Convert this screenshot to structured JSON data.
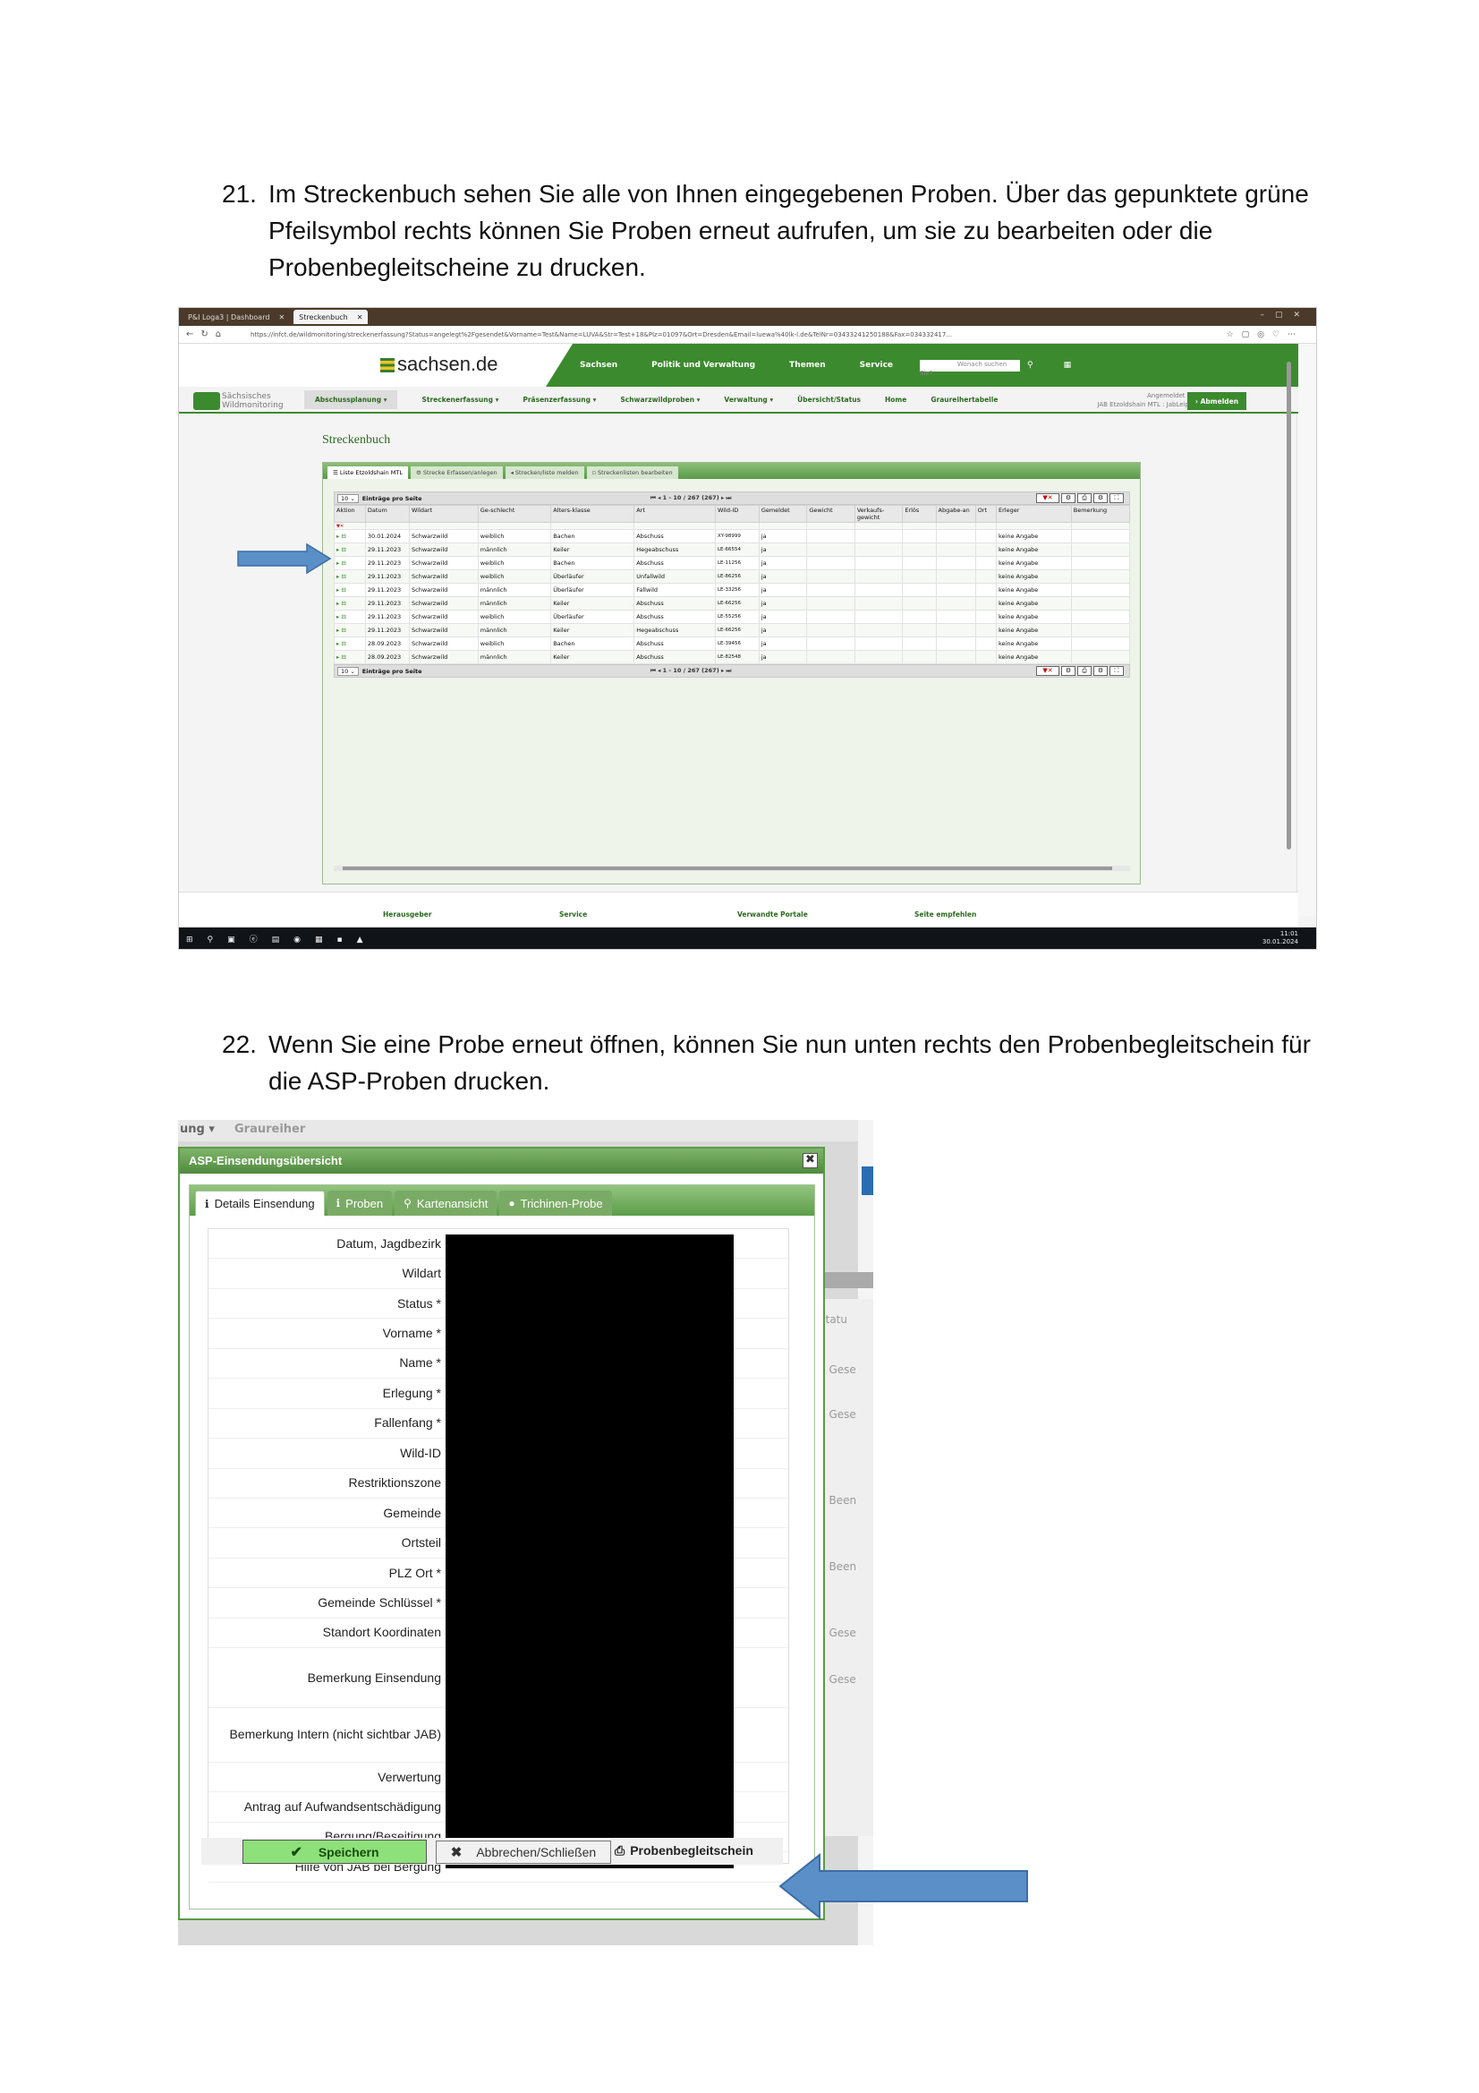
{
  "doc": {
    "step21": {
      "num": "21.",
      "text": "Im Streckenbuch sehen Sie alle von Ihnen eingegebenen Proben. Über das gepunktete grüne Pfeilsymbol rechts können Sie Proben erneut aufrufen, um sie zu bearbeiten oder die Probenbegleitscheine zu drucken."
    },
    "step22": {
      "num": "22.",
      "text": "Wenn Sie eine Probe erneut öffnen, können Sie nun unten rechts den Probenbegleitschein für die ASP-Proben drucken."
    }
  },
  "shot1": {
    "tabs": [
      "P&I Loga3 | Dashboard",
      "Streckenbuch"
    ],
    "url": "https://infct.de/wildmonitoring/streckenerfassung?Status=angelegt%2Fgesendet&Vorname=Test&Name=LÜVA&Str=Test+18&Plz=01097&Ort=Dresden&Email=luewa%40lk-l.de&TelNr=03433241250188&Fax=034332417...",
    "logo": "sachsen.de",
    "main_nav": [
      "Sachsen",
      "Politik und Verwaltung",
      "Themen",
      "Service"
    ],
    "search_placeholder": "Wonach suchen Sie?",
    "brand": [
      "Sächsisches",
      "Wildmonitoring"
    ],
    "sub_nav": [
      "Abschussplanung ▾",
      "Streckenerfassung ▾",
      "Präsenzerfassung ▾",
      "Schwarzwildproben ▾",
      "Verwaltung ▾",
      "Übersicht/Status",
      "Home",
      "Graureihertabelle"
    ],
    "user_line1": "Angemeldet als:",
    "user_line2": "JAB Etzoldshain MTL : JabLeipzig",
    "logout": "Abmelden",
    "page_title": "Streckenbuch",
    "panel_tabs": [
      "Liste Etzoldshain MTL",
      "Strecke Erfassen/anlegen",
      "Strecken/liste melden",
      "Streckenlisten bearbeiten"
    ],
    "per_page": "10",
    "per_page_label": "Einträge pro Seite",
    "pager": "1 - 10 / 267 (267)",
    "columns": [
      "Aktion",
      "Datum",
      "Wildart",
      "Ge-schlecht",
      "Alters-klasse",
      "Art",
      "Wild-ID",
      "Gemeldet",
      "Gewicht",
      "Verkaufs-gewicht",
      "Erlös",
      "Abgabe-an",
      "Ort",
      "Erleger",
      "Bemerkung"
    ],
    "rows": [
      [
        "30.01.2024",
        "Schwarzwild",
        "weiblich",
        "Bachen",
        "Abschuss",
        "XY-98999",
        "ja",
        "keine Angabe"
      ],
      [
        "29.11.2023",
        "Schwarzwild",
        "männlich",
        "Keiler",
        "Hegeabschuss",
        "LE-66554",
        "ja",
        "keine Angabe"
      ],
      [
        "29.11.2023",
        "Schwarzwild",
        "weiblich",
        "Bachen",
        "Abschuss",
        "LE-11256",
        "ja",
        "keine Angabe"
      ],
      [
        "29.11.2023",
        "Schwarzwild",
        "weiblich",
        "Überläufer",
        "Unfallwild",
        "LE-86256",
        "ja",
        "keine Angabe"
      ],
      [
        "29.11.2023",
        "Schwarzwild",
        "männlich",
        "Überläufer",
        "Fallwild",
        "LE-33256",
        "ja",
        "keine Angabe"
      ],
      [
        "29.11.2023",
        "Schwarzwild",
        "männlich",
        "Keiler",
        "Abschuss",
        "LE-66256",
        "ja",
        "keine Angabe"
      ],
      [
        "29.11.2023",
        "Schwarzwild",
        "weiblich",
        "Überläufer",
        "Abschuss",
        "LE-55256",
        "ja",
        "keine Angabe"
      ],
      [
        "29.11.2023",
        "Schwarzwild",
        "männlich",
        "Keiler",
        "Hegeabschuss",
        "LE-66256",
        "ja",
        "keine Angabe"
      ],
      [
        "28.09.2023",
        "Schwarzwild",
        "weiblich",
        "Bachen",
        "Abschuss",
        "LE-39456",
        "ja",
        "keine Angabe"
      ],
      [
        "28.09.2023",
        "Schwarzwild",
        "männlich",
        "Keiler",
        "Abschuss",
        "LE-82548",
        "ja",
        "keine Angabe"
      ]
    ],
    "footer": [
      "Herausgeber",
      "Service",
      "Verwandte Portale",
      "Seite empfehlen"
    ],
    "clock_time": "11:01",
    "clock_date": "30.01.2024"
  },
  "shot2": {
    "top": [
      "ung ▾",
      "Graureiher"
    ],
    "title": "ASP-Einsendungsübersicht",
    "close": "✖",
    "tabs": [
      "Details Einsendung",
      "Proben",
      "Kartenansicht",
      "Trichinen-Probe"
    ],
    "labels": [
      "Datum, Jagdbezirk",
      "Wildart",
      "Status *",
      "Vorname *",
      "Name *",
      "Erlegung *",
      "Fallenfang *",
      "Wild-ID",
      "Restriktionszone",
      "Gemeinde",
      "Ortsteil",
      "PLZ Ort *",
      "Gemeinde Schlüssel *",
      "Standort Koordinaten",
      "Bemerkung Einsendung",
      "Bemerkung Intern (nicht sichtbar JAB)",
      "Verwertung",
      "Antrag auf Aufwandsentschädigung",
      "Bergung/Beseitigung",
      "Hilfe von JAB bei Bergung"
    ],
    "bg_col": [
      "Statu",
      "0 Gese",
      "0 Gese",
      "0 Been",
      "0 Been",
      "0 Gese",
      "0 Gese"
    ],
    "save": "Speichern",
    "cancel": "Abbrechen/Schließen",
    "print": "Probenbegleitschein"
  },
  "colors": {
    "green": "#3c8a2e",
    "arrow": "#5b8fc7"
  }
}
